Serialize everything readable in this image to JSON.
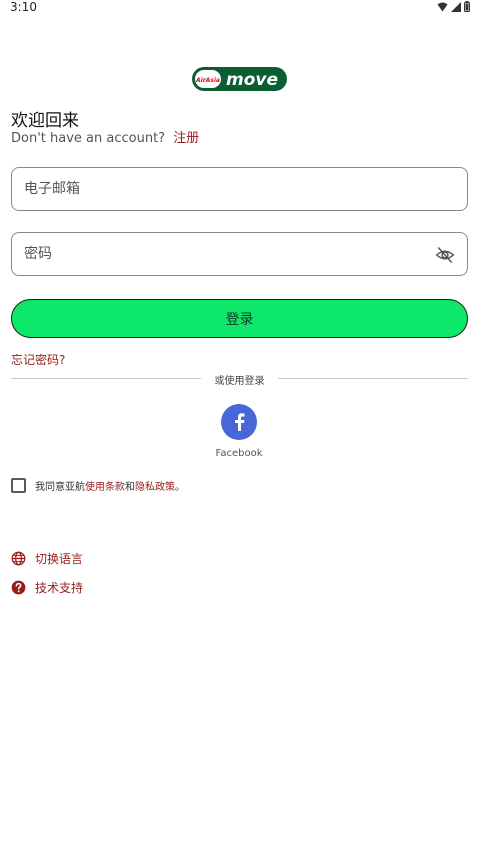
{
  "status_bar": {
    "time": "3:10"
  },
  "logo": {
    "brand_small": "AirAsia",
    "brand_main": "move"
  },
  "header": {
    "welcome": "欢迎回来",
    "no_account": "Don't have an account?",
    "signup_link": "注册"
  },
  "form": {
    "email_placeholder": "电子邮箱",
    "password_placeholder": "密码",
    "login_button": "登录",
    "forgot_password": "忘记密码?"
  },
  "divider": {
    "text": "或使用登录"
  },
  "social": {
    "facebook_label": "Facebook"
  },
  "terms": {
    "prefix": "我同意亚航",
    "terms_link": "使用条款",
    "and": "和",
    "privacy_link": "隐私政策",
    "suffix": "。"
  },
  "menu": {
    "switch_language": "切换语言",
    "support": "技术支持"
  },
  "colors": {
    "accent_green": "#0ee86a",
    "link_red": "#9a1b1b",
    "facebook_blue": "#4767d8"
  }
}
